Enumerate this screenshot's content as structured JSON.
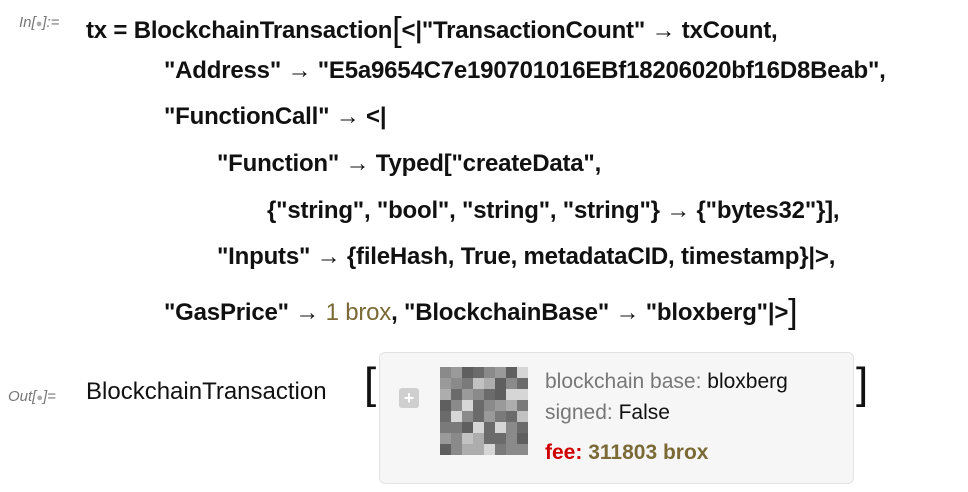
{
  "input": {
    "label": "In[",
    "label_mark": "●",
    "label_end": "]:=",
    "lines": {
      "l1_a": "tx = BlockchainTransaction",
      "l1_b": "<|\"TransactionCount\" → txCount,",
      "l2": "\"Address\" → \"E5a9654C7e190701016EBf18206020bf16D8Beab\",",
      "l3": "\"FunctionCall\" → <|",
      "l4": "\"Function\" → Typed[\"createData\",",
      "l5": "{\"string\", \"bool\", \"string\", \"string\"} → {\"bytes32\"}],",
      "l6": "\"Inputs\" → {fileHash, True, metadataCID, timestamp}|>,",
      "l7_a": "\"GasPrice\" → ",
      "l7_num": "1",
      "l7_unit": "brox",
      "l7_b": ", \"BlockchainBase\" → \"bloxberg\"|>"
    },
    "open_bracket": "[",
    "close_bracket": "]"
  },
  "output": {
    "label": "Out[",
    "label_mark": "●",
    "label_end": "]=",
    "head": "BlockchainTransaction",
    "open_bracket": "[",
    "close_bracket": "]",
    "expand_button": "+",
    "summary": {
      "base_key": "blockchain base:",
      "base_val": "bloxberg",
      "signed_key": "signed:",
      "signed_val": "False",
      "fee_key": "fee:",
      "fee_val": "311803 brox"
    },
    "icon": "blockchain-transaction-icon"
  }
}
